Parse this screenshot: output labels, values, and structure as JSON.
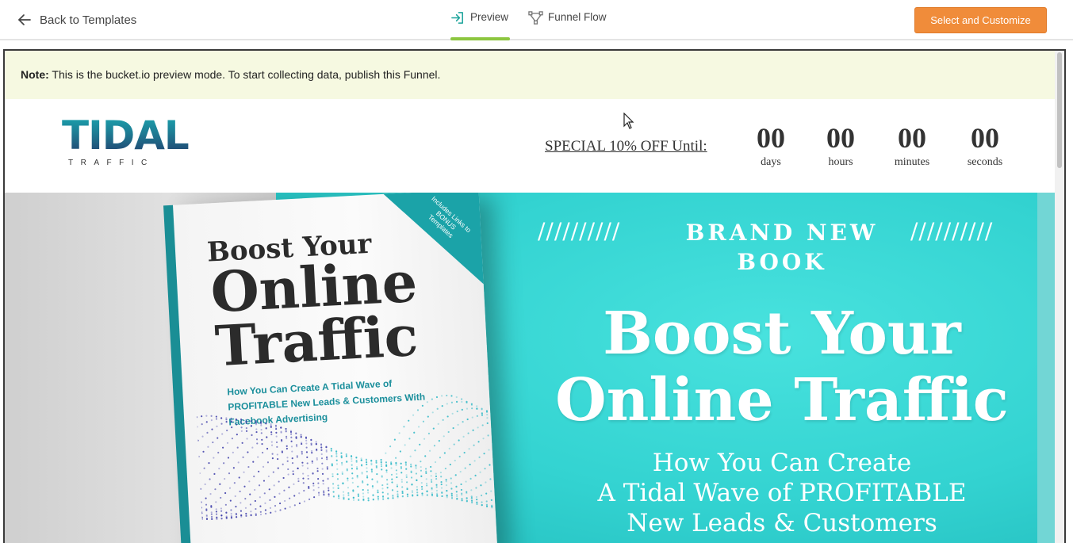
{
  "topbar": {
    "back_label": "Back to Templates",
    "tabs": [
      {
        "label": "Preview",
        "active": true
      },
      {
        "label": "Funnel Flow",
        "active": false
      }
    ],
    "cta_label": "Select and Customize",
    "cta_color": "#f08c3a",
    "active_tab_color": "#8cc63f"
  },
  "note": {
    "bold": "Note:",
    "text": " This is the bucket.io preview mode. To start collecting data, publish this Funnel."
  },
  "landing": {
    "logo": {
      "word": "TIDAL",
      "sub": "TRAFFIC"
    },
    "special": "SPECIAL 10% OFF Until:",
    "countdown": [
      {
        "value": "00",
        "label": "days"
      },
      {
        "value": "00",
        "label": "hours"
      },
      {
        "value": "00",
        "label": "minutes"
      },
      {
        "value": "00",
        "label": "seconds"
      }
    ],
    "hero": {
      "slashes_left": "//////////",
      "slashes_right": "//////////",
      "brand": "BRAND NEW",
      "brand2": "BOOK",
      "headline1": "Boost Your",
      "headline2": "Online Traffic",
      "sub1": "How You Can Create",
      "sub2": "A Tidal Wave of PROFITABLE",
      "sub3": "New Leads & Customers",
      "teal_color": "#33d3d1"
    },
    "book": {
      "title1": "Boost Your",
      "title2": "Online",
      "title3": "Traffic",
      "subtitle": "How You Can Create A Tidal Wave of PROFITABLE New Leads & Customers With Facebook Advertising",
      "corner": "Includes Links to BONUS Templates"
    }
  }
}
